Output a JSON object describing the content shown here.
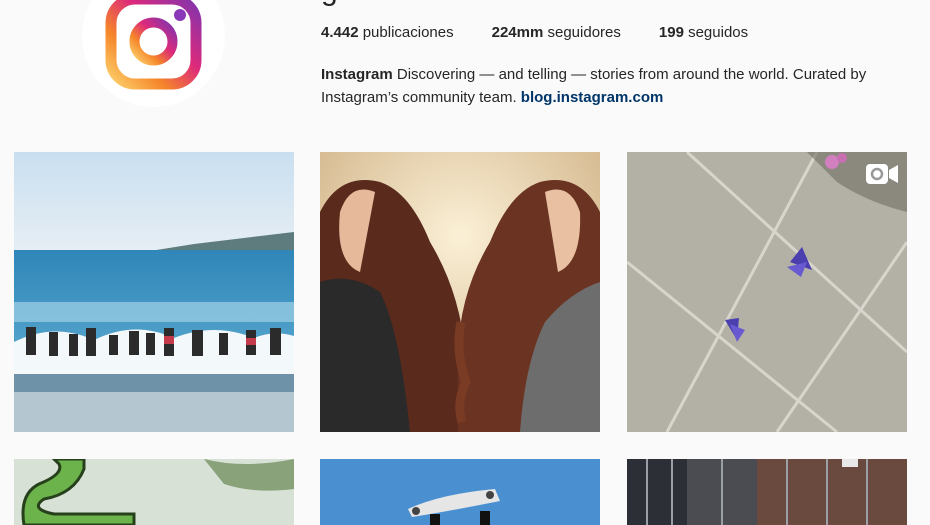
{
  "profile": {
    "username_visible": "g",
    "full_name": "Instagram",
    "bio_text": " Discovering — and telling — stories from around the world. Curated by Instagram’s community team. ",
    "link": "blog.instagram.com"
  },
  "stats": {
    "posts_count": "4.442",
    "posts_label": "publicaciones",
    "followers_count": "224mm",
    "followers_label": "seguidores",
    "following_count": "199",
    "following_label": "seguidos"
  },
  "icons": {
    "avatar": "instagram-logo-icon",
    "video_badge": "video-camera-icon"
  },
  "colors": {
    "link": "#003569",
    "background": "#fafafa",
    "text": "#262626"
  }
}
